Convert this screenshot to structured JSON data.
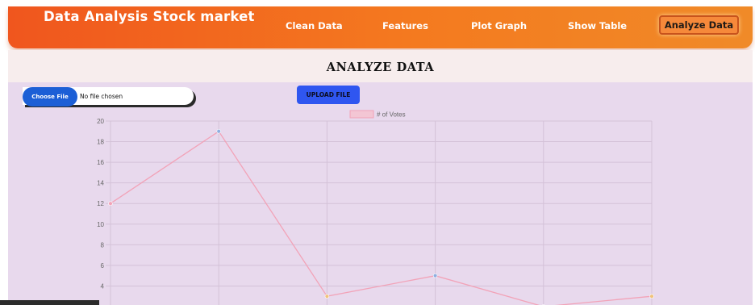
{
  "navbar": {
    "brand": "Data Analysis Stock market",
    "links": [
      {
        "label": "Clean Data"
      },
      {
        "label": "Features"
      },
      {
        "label": "Plot Graph"
      },
      {
        "label": "Show Table"
      }
    ],
    "active": {
      "label": "Analyze Data"
    }
  },
  "page_title": "ANALYZE DATA",
  "upload": {
    "choose_label": "Choose File",
    "status": "No file chosen",
    "upload_label": "UPLOAD FILE"
  },
  "colors": {
    "nav_start": "#f0561e",
    "nav_end": "#f08a28",
    "panel_bg": "#e8d9ed",
    "line": "#f2a3b8",
    "choose_button": "#1c5fd6",
    "upload_button": "#2f56f0"
  },
  "chart_data": {
    "type": "line",
    "legend": "# of Votes",
    "legend_position": "top",
    "series": [
      {
        "name": "# of Votes",
        "values": [
          12,
          19,
          3,
          5,
          2,
          3
        ]
      }
    ],
    "y_ticks": [
      4,
      6,
      8,
      10,
      12,
      14,
      16,
      18,
      20
    ],
    "ylim": [
      2,
      20
    ],
    "grid": true,
    "point_colors": [
      "#f2a3b8",
      "#8eaee0",
      "#f0c27a",
      "#8eaee0",
      "#c8a8d8",
      "#f0c27a"
    ]
  }
}
